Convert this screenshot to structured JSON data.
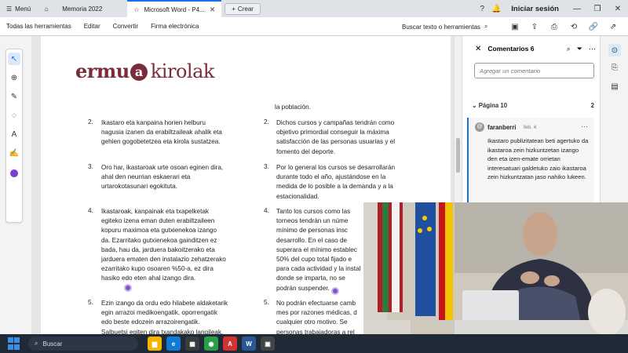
{
  "tabbar": {
    "menu_label": "Menú",
    "tabs": [
      {
        "label": "Memoria 2022"
      },
      {
        "label": "Microsoft Word - P4..."
      }
    ],
    "new_tab_label": "Crear",
    "signin_label": "Iniciar sesión"
  },
  "toolbar": {
    "items": [
      "Todas las herramientas",
      "Editar",
      "Convertir",
      "Firma electrónica"
    ],
    "search_label": "Buscar texto o herramientas"
  },
  "document": {
    "logo_left": "ermu",
    "logo_mark": "a",
    "logo_right": "kirolak",
    "right_top_fragment": "la población.",
    "left_items": [
      {
        "number": "2.",
        "lines": [
          "Ikastaro eta kanpaina horien helburu",
          "nagusia izanen da erabiltzaileak ahalik eta",
          "gehien gogobetetzea eta kirola sustatzea."
        ]
      },
      {
        "number": "3.",
        "lines": [
          "Oro har, ikastaroak urte osoan eginen dira,",
          "ahal den neurrian eskaerari eta",
          "urtarokotasunari egokituta."
        ]
      },
      {
        "number": "4.",
        "lines": [
          "Ikastaroak, kanpainak eta txapelketak",
          "egiteko izena eman duten erabiltzaileen",
          "kopuru maximoa eta gutxienekoa izango",
          "da. Ezarritako gutxienekoa gainditzen ez",
          "bada, hau da, jarduera bakoitzerako eta",
          "jarduera ematen den instalazio zehatzerako",
          "ezarritako kupo osoaren %50-a, ez dira",
          "hasiko edo eten ahal izango dira."
        ]
      },
      {
        "number": "5.",
        "lines": [
          "Ezin izango da ordu edo hilabete aldaketarik",
          "egin arrazoi medikoengatik, oporrengatik",
          "edo beste edozein arrazoirengatik.",
          "Salbuetsi egiten dira txandakako langileak,"
        ]
      }
    ],
    "right_items": [
      {
        "number": "2.",
        "lines": [
          "Dichos cursos y campañas tendrán como",
          "objetivo primordial conseguir la máxima",
          "satisfacción de las personas usuarias y el",
          "fomento del deporte."
        ]
      },
      {
        "number": "3.",
        "lines": [
          "Por lo general los cursos se desarrollarán",
          "durante todo el año, ajustándose en la",
          "medida de lo posible a la demanda y a la",
          "estacionalidad."
        ]
      },
      {
        "number": "4.",
        "lines": [
          "Tanto los cursos como las",
          "torneos tendrán un núme",
          "mínimo de personas insc",
          "desarrollo. En el caso de",
          "superara el mínimo establec",
          "50% del cupo total fijado e",
          "para cada actividad y la instal",
          "donde se imparta, no se",
          "podrán suspender."
        ]
      },
      {
        "number": "5.",
        "lines": [
          "No podrán efectuarse camb",
          "mes por razones médicas, d",
          "cualquier otro motivo. Se",
          "personas trabajadoras a rel"
        ]
      }
    ]
  },
  "comments": {
    "title": "Comentarios 6",
    "add_placeholder": "Agregar un comentario",
    "page_label": "Página 10",
    "page_count": "2",
    "card": {
      "author": "faranberri",
      "date": "feb. 4",
      "body": "Ikastaro publizitatean beti agertuko da ikastaroa zein hizkuntzetan izango den eta izen-emate orrietan interesatuari galdetuko zaio ikastaroa zein hizkuntzatan jaso nahiko lukeen."
    }
  },
  "taskbar": {
    "search_label": "Buscar"
  }
}
